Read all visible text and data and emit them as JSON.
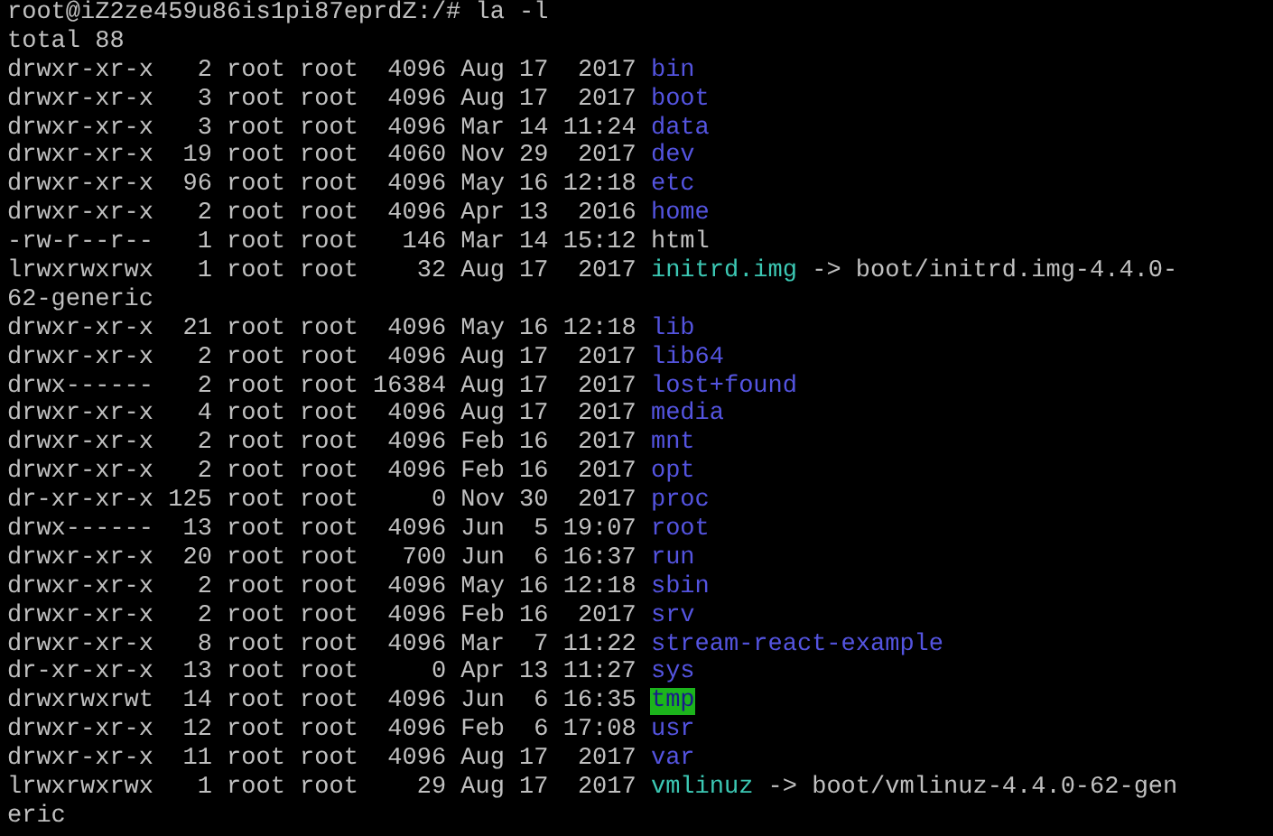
{
  "terminal": {
    "lines": [
      {
        "segments": [
          {
            "kind": "prompt",
            "text": "root@iZ2ze459u86is1pi87eprdZ:/# la -l"
          }
        ]
      },
      {
        "segments": [
          {
            "kind": "text",
            "text": "total 88"
          }
        ]
      },
      {
        "segments": [
          {
            "kind": "info",
            "text": "drwxr-xr-x   2 root root  4096 Aug 17  2017"
          },
          {
            "kind": "dir",
            "text": "bin"
          }
        ]
      },
      {
        "segments": [
          {
            "kind": "info",
            "text": "drwxr-xr-x   3 root root  4096 Aug 17  2017"
          },
          {
            "kind": "dir",
            "text": "boot"
          }
        ]
      },
      {
        "segments": [
          {
            "kind": "info",
            "text": "drwxr-xr-x   3 root root  4096 Mar 14 11:24"
          },
          {
            "kind": "dir",
            "text": "data"
          }
        ]
      },
      {
        "segments": [
          {
            "kind": "info",
            "text": "drwxr-xr-x  19 root root  4060 Nov 29  2017"
          },
          {
            "kind": "dir",
            "text": "dev"
          }
        ]
      },
      {
        "segments": [
          {
            "kind": "info",
            "text": "drwxr-xr-x  96 root root  4096 May 16 12:18"
          },
          {
            "kind": "dir",
            "text": "etc"
          }
        ]
      },
      {
        "segments": [
          {
            "kind": "info",
            "text": "drwxr-xr-x   2 root root  4096 Apr 13  2016"
          },
          {
            "kind": "dir",
            "text": "home"
          }
        ]
      },
      {
        "segments": [
          {
            "kind": "info",
            "text": "-rw-r--r--   1 root root   146 Mar 14 15:12"
          },
          {
            "kind": "file",
            "text": "html"
          }
        ]
      },
      {
        "segments": [
          {
            "kind": "info",
            "text": "lrwxrwxrwx   1 root root    32 Aug 17  2017"
          },
          {
            "kind": "link",
            "text": "initrd.img"
          },
          {
            "kind": "target",
            "text": "-> boot/initrd.img-4.4.0-"
          }
        ]
      },
      {
        "segments": [
          {
            "kind": "target",
            "text": "62-generic"
          }
        ]
      },
      {
        "segments": [
          {
            "kind": "info",
            "text": "drwxr-xr-x  21 root root  4096 May 16 12:18"
          },
          {
            "kind": "dir",
            "text": "lib"
          }
        ]
      },
      {
        "segments": [
          {
            "kind": "info",
            "text": "drwxr-xr-x   2 root root  4096 Aug 17  2017"
          },
          {
            "kind": "dir",
            "text": "lib64"
          }
        ]
      },
      {
        "segments": [
          {
            "kind": "info",
            "text": "drwx------   2 root root 16384 Aug 17  2017"
          },
          {
            "kind": "dir",
            "text": "lost+found"
          }
        ]
      },
      {
        "segments": [
          {
            "kind": "info",
            "text": "drwxr-xr-x   4 root root  4096 Aug 17  2017"
          },
          {
            "kind": "dir",
            "text": "media"
          }
        ]
      },
      {
        "segments": [
          {
            "kind": "info",
            "text": "drwxr-xr-x   2 root root  4096 Feb 16  2017"
          },
          {
            "kind": "dir",
            "text": "mnt"
          }
        ]
      },
      {
        "segments": [
          {
            "kind": "info",
            "text": "drwxr-xr-x   2 root root  4096 Feb 16  2017"
          },
          {
            "kind": "dir",
            "text": "opt"
          }
        ]
      },
      {
        "segments": [
          {
            "kind": "info",
            "text": "dr-xr-xr-x 125 root root     0 Nov 30  2017"
          },
          {
            "kind": "dir",
            "text": "proc"
          }
        ]
      },
      {
        "segments": [
          {
            "kind": "info",
            "text": "drwx------  13 root root  4096 Jun  5 19:07"
          },
          {
            "kind": "dir",
            "text": "root"
          }
        ]
      },
      {
        "segments": [
          {
            "kind": "info",
            "text": "drwxr-xr-x  20 root root   700 Jun  6 16:37"
          },
          {
            "kind": "dir",
            "text": "run"
          }
        ]
      },
      {
        "segments": [
          {
            "kind": "info",
            "text": "drwxr-xr-x   2 root root  4096 May 16 12:18"
          },
          {
            "kind": "dir",
            "text": "sbin"
          }
        ]
      },
      {
        "segments": [
          {
            "kind": "info",
            "text": "drwxr-xr-x   2 root root  4096 Feb 16  2017"
          },
          {
            "kind": "dir",
            "text": "srv"
          }
        ]
      },
      {
        "segments": [
          {
            "kind": "info",
            "text": "drwxr-xr-x   8 root root  4096 Mar  7 11:22"
          },
          {
            "kind": "dir",
            "text": "stream-react-example"
          }
        ]
      },
      {
        "segments": [
          {
            "kind": "info",
            "text": "dr-xr-xr-x  13 root root     0 Apr 13 11:27"
          },
          {
            "kind": "dir",
            "text": "sys"
          }
        ]
      },
      {
        "segments": [
          {
            "kind": "info",
            "text": "drwxrwxrwt  14 root root  4096 Jun  6 16:35"
          },
          {
            "kind": "sticky",
            "text": "tmp"
          }
        ]
      },
      {
        "segments": [
          {
            "kind": "info",
            "text": "drwxr-xr-x  12 root root  4096 Feb  6 17:08"
          },
          {
            "kind": "dir",
            "text": "usr"
          }
        ]
      },
      {
        "segments": [
          {
            "kind": "info",
            "text": "drwxr-xr-x  11 root root  4096 Aug 17  2017"
          },
          {
            "kind": "dir",
            "text": "var"
          }
        ]
      },
      {
        "segments": [
          {
            "kind": "info",
            "text": "lrwxrwxrwx   1 root root    29 Aug 17  2017"
          },
          {
            "kind": "link",
            "text": "vmlinuz"
          },
          {
            "kind": "target",
            "text": "-> boot/vmlinuz-4.4.0-62-gen"
          }
        ]
      },
      {
        "segments": [
          {
            "kind": "target",
            "text": "eric"
          }
        ]
      }
    ]
  }
}
